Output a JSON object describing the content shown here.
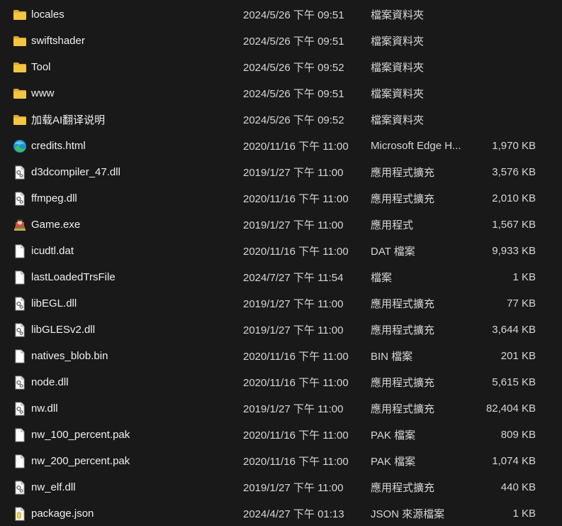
{
  "files": [
    {
      "name": "locales",
      "date": "2024/5/26 下午 09:51",
      "type": "檔案資料夾",
      "size": "",
      "icon": "folder-icon"
    },
    {
      "name": "swiftshader",
      "date": "2024/5/26 下午 09:51",
      "type": "檔案資料夾",
      "size": "",
      "icon": "folder-icon"
    },
    {
      "name": "Tool",
      "date": "2024/5/26 下午 09:52",
      "type": "檔案資料夾",
      "size": "",
      "icon": "folder-icon"
    },
    {
      "name": "www",
      "date": "2024/5/26 下午 09:51",
      "type": "檔案資料夾",
      "size": "",
      "icon": "folder-icon"
    },
    {
      "name": "加载AI翻译说明",
      "date": "2024/5/26 下午 09:52",
      "type": "檔案資料夾",
      "size": "",
      "icon": "folder-icon"
    },
    {
      "name": "credits.html",
      "date": "2020/11/16 下午 11:00",
      "type": "Microsoft Edge H...",
      "size": "1,970 KB",
      "icon": "edge-icon"
    },
    {
      "name": "d3dcompiler_47.dll",
      "date": "2019/1/27 下午 11:00",
      "type": "應用程式擴充",
      "size": "3,576 KB",
      "icon": "dll-icon"
    },
    {
      "name": "ffmpeg.dll",
      "date": "2020/11/16 下午 11:00",
      "type": "應用程式擴充",
      "size": "2,010 KB",
      "icon": "dll-icon"
    },
    {
      "name": "Game.exe",
      "date": "2019/1/27 下午 11:00",
      "type": "應用程式",
      "size": "1,567 KB",
      "icon": "game-exe-icon"
    },
    {
      "name": "icudtl.dat",
      "date": "2020/11/16 下午 11:00",
      "type": "DAT 檔案",
      "size": "9,933 KB",
      "icon": "blank-file-icon"
    },
    {
      "name": "lastLoadedTrsFile",
      "date": "2024/7/27 下午 11:54",
      "type": "檔案",
      "size": "1 KB",
      "icon": "blank-file-icon"
    },
    {
      "name": "libEGL.dll",
      "date": "2019/1/27 下午 11:00",
      "type": "應用程式擴充",
      "size": "77 KB",
      "icon": "dll-icon"
    },
    {
      "name": "libGLESv2.dll",
      "date": "2019/1/27 下午 11:00",
      "type": "應用程式擴充",
      "size": "3,644 KB",
      "icon": "dll-icon"
    },
    {
      "name": "natives_blob.bin",
      "date": "2020/11/16 下午 11:00",
      "type": "BIN 檔案",
      "size": "201 KB",
      "icon": "blank-file-icon"
    },
    {
      "name": "node.dll",
      "date": "2020/11/16 下午 11:00",
      "type": "應用程式擴充",
      "size": "5,615 KB",
      "icon": "dll-icon"
    },
    {
      "name": "nw.dll",
      "date": "2019/1/27 下午 11:00",
      "type": "應用程式擴充",
      "size": "82,404 KB",
      "icon": "dll-icon"
    },
    {
      "name": "nw_100_percent.pak",
      "date": "2020/11/16 下午 11:00",
      "type": "PAK 檔案",
      "size": "809 KB",
      "icon": "blank-file-icon"
    },
    {
      "name": "nw_200_percent.pak",
      "date": "2020/11/16 下午 11:00",
      "type": "PAK 檔案",
      "size": "1,074 KB",
      "icon": "blank-file-icon"
    },
    {
      "name": "nw_elf.dll",
      "date": "2019/1/27 下午 11:00",
      "type": "應用程式擴充",
      "size": "440 KB",
      "icon": "dll-icon"
    },
    {
      "name": "package.json",
      "date": "2024/4/27 下午 01:13",
      "type": "JSON 來源檔案",
      "size": "1 KB",
      "icon": "json-file-icon"
    }
  ],
  "colors": {
    "background": "#191919",
    "folder": "#f4c542",
    "folder_dark": "#dca731",
    "edge_blue": "#1f8fd6",
    "edge_green": "#3fbf5a"
  }
}
